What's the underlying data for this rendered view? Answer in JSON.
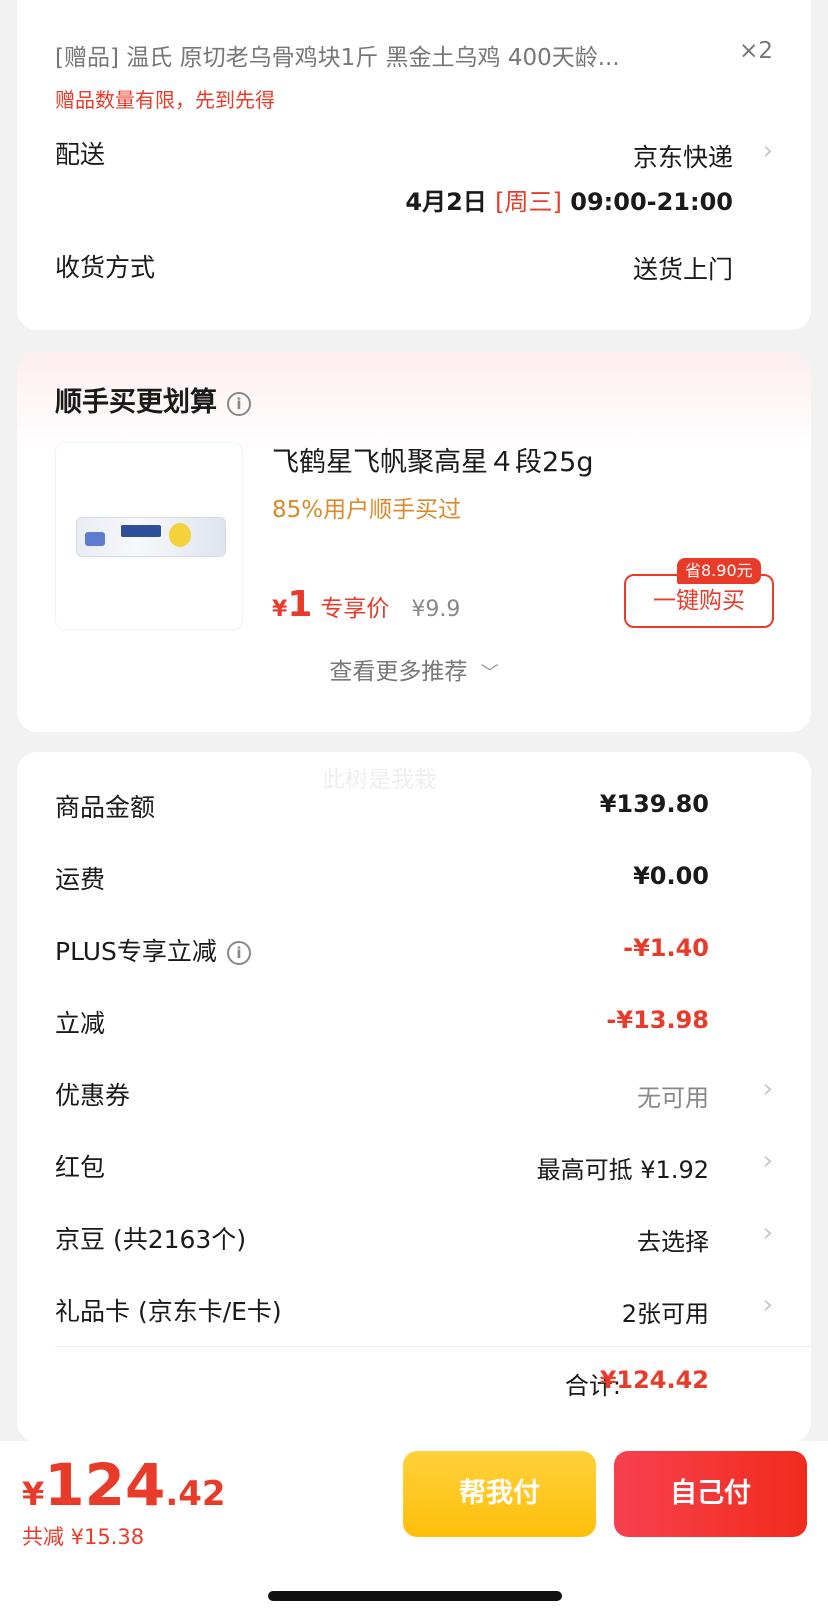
{
  "delivery": {
    "gift_line": "[赠品] 温氏 原切老乌骨鸡块1斤 黑金土乌鸡 400天龄...",
    "gift_qty": "×2",
    "gift_note": "赠品数量有限，先到先得",
    "ship_label": "配送",
    "ship_value": "京东快递",
    "date": "4月2日",
    "weekday": "[周三]",
    "time": "09:00-21:00",
    "receive_label": "收货方式",
    "receive_value": "送货上门"
  },
  "recommend": {
    "title": "顺手买更划算",
    "product_name": "飞鹤星飞帆聚高星４段25g",
    "users": "85%用户顺手买过",
    "price_symbol": "¥",
    "price": "1",
    "price_tag": "专享价",
    "orig_price": "¥9.9",
    "save_badge": "省8.90元",
    "buy_label": "一键购买",
    "more_label": "查看更多推荐",
    "more_icon": "chevron-down-icon"
  },
  "summary": {
    "watermark": "此树是我栽",
    "rows": [
      {
        "label": "商品金额",
        "value": "¥139.80"
      },
      {
        "label": "运费",
        "value": "¥0.00"
      },
      {
        "label": "PLUS专享立减",
        "value": "-¥1.40"
      },
      {
        "label": "立减",
        "value": "-¥13.98"
      },
      {
        "label": "优惠券",
        "value": "无可用"
      },
      {
        "label": "红包",
        "value": "最高可抵 ¥1.92"
      },
      {
        "label": "京豆 (共2163个)",
        "value": "去选择"
      },
      {
        "label": "礼品卡 (京东卡/E卡)",
        "value": "2张可用"
      }
    ],
    "total_label": "合计:",
    "total_value": "¥124.42"
  },
  "bottom": {
    "yen": "¥",
    "amount_int": "124",
    "amount_dec": ".42",
    "saving": "共减 ¥15.38",
    "help_pay": "帮我付",
    "self_pay": "自己付"
  },
  "colors": {
    "accent_red": "#e93b2a",
    "gold": "#ffc21a",
    "orange_text": "#d98a2c"
  }
}
